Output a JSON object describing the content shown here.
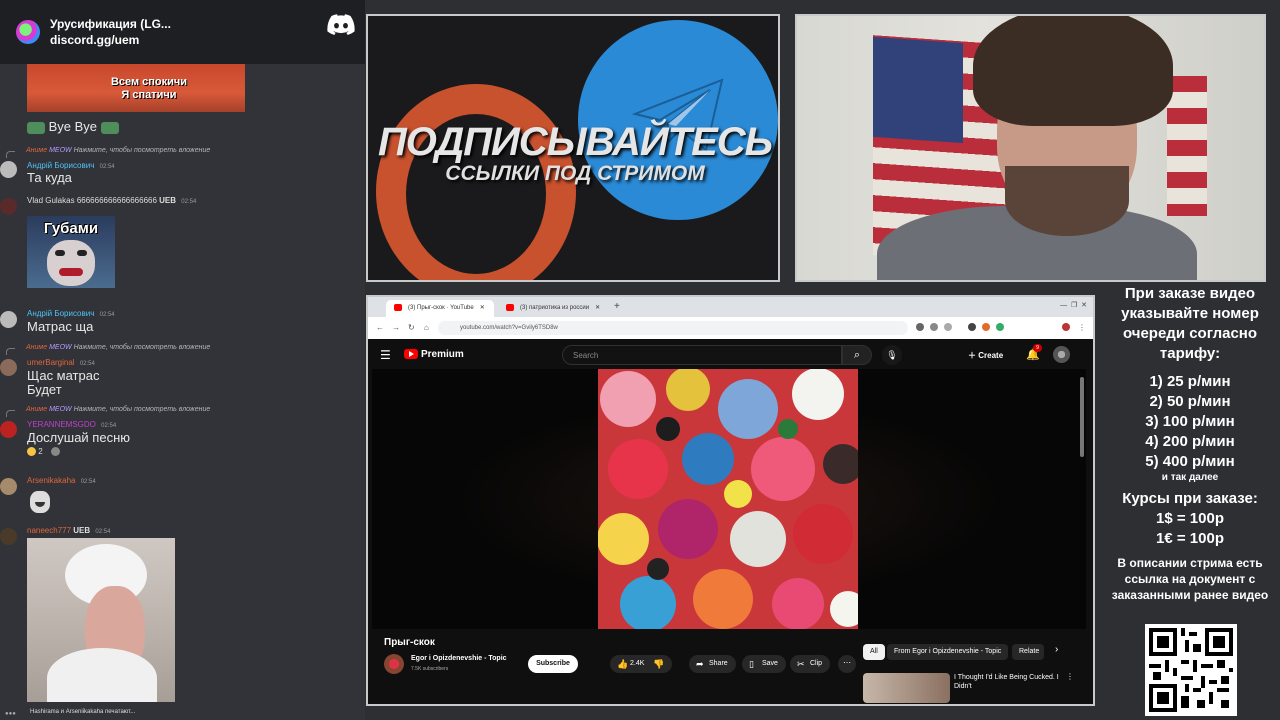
{
  "discord": {
    "server_name": "Урусификация (LG...",
    "invite": "discord.gg/uem",
    "emote_top": {
      "line1": "Всем спокичи",
      "line2": "Я спатичи"
    },
    "messages": [
      {
        "text": "Bye Bye"
      },
      {
        "reply": "Нажмите, чтобы посмотреть вложение",
        "reply_tag": "MEOW",
        "reply_user": "Аниме",
        "user": "Андрій Борисович",
        "user_color": "#4fc3f7",
        "time": "02:54",
        "text": "Та куда"
      },
      {
        "user": "Vlad Gulakas",
        "user_color": "#dddddd",
        "user_suffix": "666666666666666666",
        "tag": "UEB",
        "time": "02:54",
        "emote_label": "Губами"
      },
      {
        "user": "Андрій Борисович",
        "user_color": "#4fc3f7",
        "time": "02:54",
        "text": "Матрас ща"
      },
      {
        "reply": "Нажмите, чтобы посмотреть вложение",
        "reply_tag": "MEOW",
        "reply_user": "Аниме",
        "user": "umerBarginal",
        "user_color": "#e0663b",
        "time": "02:54",
        "text": "Щас матрас",
        "text2": "Будет"
      },
      {
        "reply": "Нажмите, чтобы посмотреть вложение",
        "reply_tag": "MEOW",
        "reply_user": "Аниме",
        "user": "YERANNEMSGDO",
        "user_color": "#c040d0",
        "time": "02:54",
        "text": "Дослушай песню",
        "reaction_count": "2"
      },
      {
        "user": "Arsenikakaha",
        "user_color": "#e0663b",
        "time": "02:54"
      },
      {
        "user": "naneech777",
        "user_color": "#e0663b",
        "tag": "UEB",
        "time": "02:54"
      }
    ],
    "typing": "Hashirama и Arseniikakaha печатают..."
  },
  "promo": {
    "headline": "ПОДПИСЫВАЙТЕСЬ",
    "subline": "ССЫЛКИ ПОД СТРИМОМ"
  },
  "browser": {
    "tab1": "(3) Прыг-скок · YouTube",
    "tab2": "(3) патриотика из россии",
    "url": "youtube.com/watch?v=Gvily6TSD8w"
  },
  "youtube": {
    "brand": "Premium",
    "search_placeholder": "Search",
    "create": "Create",
    "notif_count": "9",
    "video_title": "Прыг-скок",
    "channel": "Egor i Opizdenevshie - Topic",
    "subscribers": "7.5K subscribers",
    "subscribe": "Subscribe",
    "likes": "2.4K",
    "share": "Share",
    "save": "Save",
    "clip": "Clip",
    "chips": [
      "All",
      "From Egor i Opizdenevshie - Topic",
      "Relate"
    ],
    "rec_title": "I Thought I'd Like Being Cucked. I Didn't"
  },
  "info": {
    "p1": "При заказе видео указывайте номер очереди согласно тарифу:",
    "rates": [
      "1) 25 р/мин",
      "2) 50 р/мин",
      "3) 100 р/мин",
      "4) 200 р/мин",
      "5) 400 р/мин"
    ],
    "etc": "и так далее",
    "courses_title": "Курсы при заказе:",
    "usd": "1$ = 100р",
    "eur": "1€ = 100р",
    "p3": "В описании стрима есть ссылка на документ с заказанными ранее видео"
  },
  "colors": {
    "youtube_red": "#ff0000",
    "discord_bg": "#313338",
    "telegram_blue": "#2a8ad6",
    "patreon_orange": "#c8512e"
  }
}
